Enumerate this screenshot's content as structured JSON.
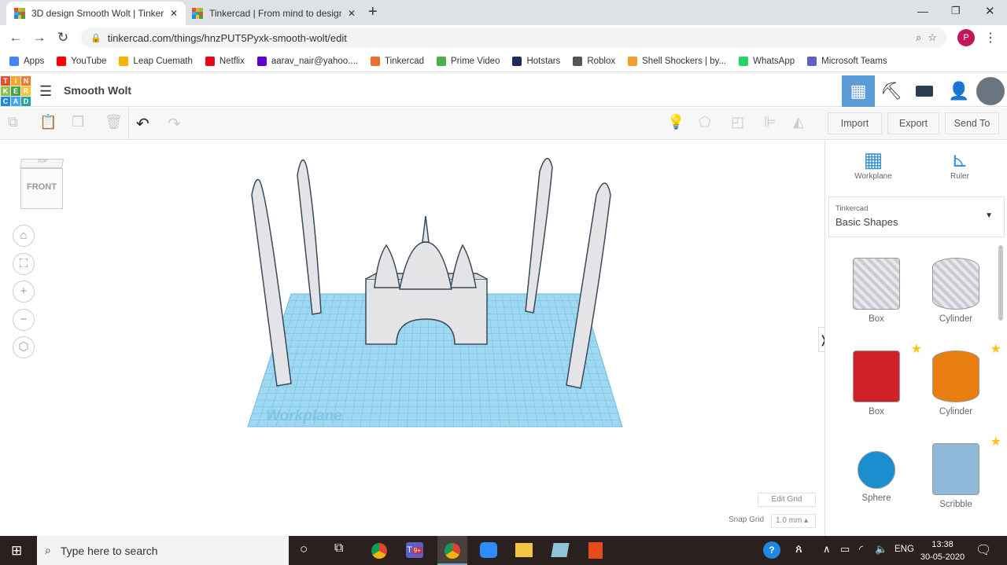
{
  "browser": {
    "tabs": [
      {
        "title": "3D design Smooth Wolt | Tinkercad",
        "active": true
      },
      {
        "title": "Tinkercad | From mind to design in minutes",
        "active": false
      }
    ],
    "url": "tinkercad.com/things/hnzPUT5Pyxk-smooth-wolt/edit",
    "profile_initial": "P",
    "bookmarks": [
      {
        "label": "Apps",
        "color": "#4285f4"
      },
      {
        "label": "YouTube",
        "color": "#ff0000"
      },
      {
        "label": "Leap Cuemath",
        "color": "#f4b400"
      },
      {
        "label": "Netflix",
        "color": "#e50914"
      },
      {
        "label": "aarav_nair@yahoo....",
        "color": "#6001d2"
      },
      {
        "label": "Tinkercad",
        "color": "#e8702a"
      },
      {
        "label": "Prime Video",
        "color": "#4caf50"
      },
      {
        "label": "Hotstars",
        "color": "#1f2a5c"
      },
      {
        "label": "Roblox",
        "color": "#555555"
      },
      {
        "label": "Shell Shockers | by...",
        "color": "#f0a030"
      },
      {
        "label": "WhatsApp",
        "color": "#25d366"
      },
      {
        "label": "Microsoft Teams",
        "color": "#5b5fc7"
      }
    ]
  },
  "app": {
    "logo_letters": [
      "T",
      "I",
      "N",
      "K",
      "E",
      "R",
      "C",
      "A",
      "D"
    ],
    "design_title": "Smooth Wolt",
    "toolbar": {
      "import": "Import",
      "export": "Export",
      "send_to": "Send To"
    },
    "view_cube": {
      "top": "TOP",
      "front": "FRONT"
    },
    "workplane_label": "Workplane",
    "panel": {
      "workplane": "Workplane",
      "ruler": "Ruler",
      "library_group": "Tinkercad",
      "library_selected": "Basic Shapes",
      "shapes": [
        {
          "name": "Box",
          "style": "hole"
        },
        {
          "name": "Cylinder",
          "style": "hole"
        },
        {
          "name": "Box",
          "style": "solid",
          "color": "#d0202a",
          "starred": true
        },
        {
          "name": "Cylinder",
          "style": "solid",
          "color": "#e87d10",
          "starred": true
        },
        {
          "name": "Sphere",
          "style": "solid",
          "color": "#1a8fcf"
        },
        {
          "name": "Scribble",
          "style": "solid",
          "color": "#8fb8d8",
          "starred": true
        }
      ]
    },
    "grid": {
      "edit_grid": "Edit Grid",
      "snap_label": "Snap Grid",
      "snap_value": "1.0 mm"
    },
    "accent": "#5a9bd8"
  },
  "taskbar": {
    "search_placeholder": "Type here to search",
    "teams_badge": "9+",
    "language": "ENG",
    "time": "13:38",
    "date": "30-05-2020"
  }
}
